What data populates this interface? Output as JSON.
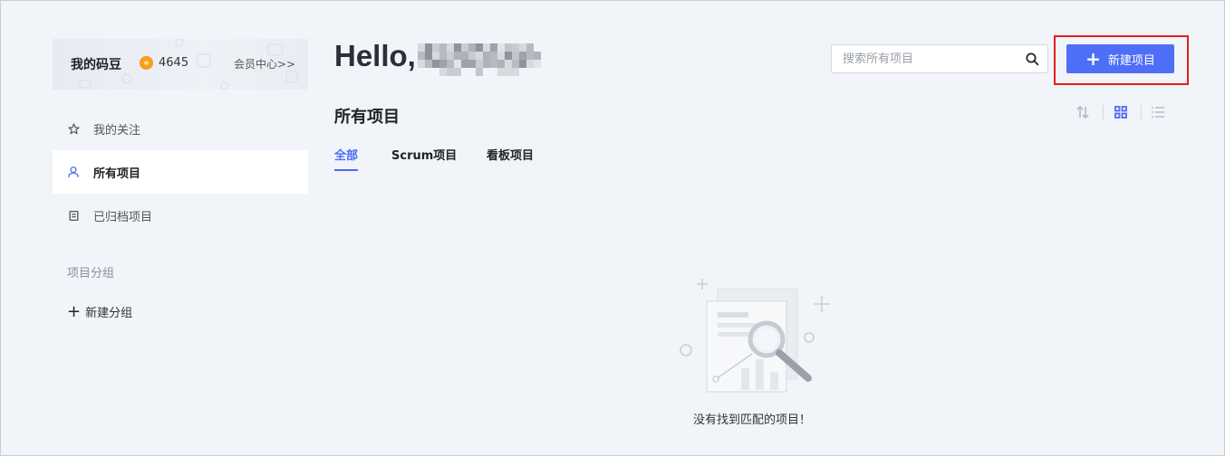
{
  "member": {
    "title": "我的码豆",
    "coins": "4645",
    "center_link": "会员中心>>"
  },
  "sidebar": {
    "items": [
      {
        "label": "我的关注",
        "icon": "star-icon",
        "active": false
      },
      {
        "label": "所有项目",
        "icon": "user-icon",
        "active": true
      },
      {
        "label": "已归档项目",
        "icon": "archive-icon",
        "active": false
      }
    ],
    "group_label": "项目分组",
    "new_group": "新建分组"
  },
  "header": {
    "greeting": "Hello,",
    "search_placeholder": "搜索所有项目",
    "new_project": "新建项目"
  },
  "main": {
    "title": "所有项目",
    "tabs": [
      {
        "label": "全部",
        "active": true
      },
      {
        "label": "Scrum项目",
        "active": false
      },
      {
        "label": "看板项目",
        "active": false
      }
    ],
    "empty_message": "没有找到匹配的项目！"
  },
  "colors": {
    "accent": "#4f6ef7",
    "highlight": "#e02020",
    "background": "#f1f4f8"
  }
}
